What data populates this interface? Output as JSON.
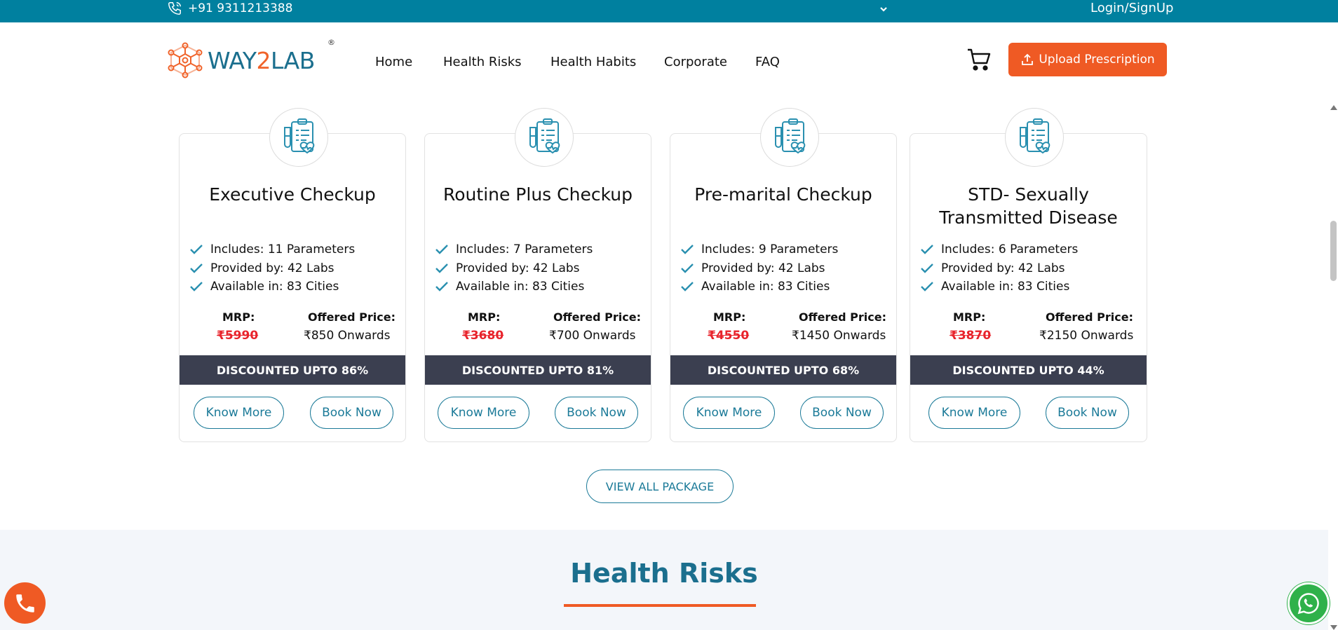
{
  "topbar": {
    "phone": "+91 9311213388",
    "login": "Login/SignUp"
  },
  "header": {
    "logo_way": "WAY",
    "logo_two": "2",
    "logo_lab": "LAB",
    "logo_reg": "®",
    "nav": [
      "Home",
      "Health Risks",
      "Health Habits",
      "Corporate",
      "FAQ"
    ],
    "upload_label": "Upload Prescription"
  },
  "packages": [
    {
      "title": "Executive Checkup",
      "features": [
        "Includes: 11 Parameters",
        "Provided by: 42 Labs",
        "Available in: 83 Cities"
      ],
      "mrp_label": "MRP:",
      "mrp": "₹5990",
      "offer_label": "Offered Price:",
      "offer": "₹850 Onwards",
      "discount": "DISCOUNTED UPTO 86%",
      "know_more": "Know More",
      "book_now": "Book Now"
    },
    {
      "title": "Routine Plus Checkup",
      "features": [
        "Includes: 7 Parameters",
        "Provided by: 42 Labs",
        "Available in: 83 Cities"
      ],
      "mrp_label": "MRP:",
      "mrp": "₹3680",
      "offer_label": "Offered Price:",
      "offer": "₹700 Onwards",
      "discount": "DISCOUNTED UPTO 81%",
      "know_more": "Know More",
      "book_now": "Book Now"
    },
    {
      "title": "Pre-marital Checkup",
      "features": [
        "Includes: 9 Parameters",
        "Provided by: 42 Labs",
        "Available in: 83 Cities"
      ],
      "mrp_label": "MRP:",
      "mrp": "₹4550",
      "offer_label": "Offered Price:",
      "offer": "₹1450 Onwards",
      "discount": "DISCOUNTED UPTO 68%",
      "know_more": "Know More",
      "book_now": "Book Now"
    },
    {
      "title_line1": "STD- Sexually",
      "title_line2": "Transmitted Disease",
      "features": [
        "Includes: 6 Parameters",
        "Provided by: 42 Labs",
        "Available in: 83 Cities"
      ],
      "mrp_label": "MRP:",
      "mrp": "₹3870",
      "offer_label": "Offered Price:",
      "offer": "₹2150 Onwards",
      "discount": "DISCOUNTED UPTO 44%",
      "know_more": "Know More",
      "book_now": "Book Now"
    }
  ],
  "view_all": "VIEW ALL PACKAGE",
  "risks_heading": "Health Risks",
  "icons": {
    "phone": "phone-icon",
    "chevron": "chevron-down-icon",
    "cart": "cart-icon",
    "upload": "upload-icon",
    "package": "clipboard-heart-icon",
    "check": "check-icon",
    "call_fab": "phone-icon",
    "whatsapp": "whatsapp-icon"
  },
  "colors": {
    "topbar": "#00809f",
    "brand_blue": "#1b6f8e",
    "accent_orange": "#ef5a24",
    "discount_bar": "#3b3f50",
    "mrp_red": "#e8242c",
    "whatsapp_green": "#2fb14a"
  }
}
